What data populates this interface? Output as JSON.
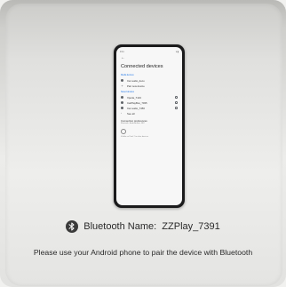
{
  "phone": {
    "status_time": "9:41",
    "status_icons": "▾ ▮",
    "back_glyph": "←",
    "title": "Connected devices",
    "section_media": "Media devices",
    "media_device": "Car audio_deco",
    "pair_new": "Pair new device",
    "section_previous": "Saved devices",
    "saved_devices": [
      "Xperia_7143",
      "CarPlayBox_7035",
      "Car audio_7456"
    ],
    "see_all": "See all",
    "prefs_title": "Connection preferences",
    "prefs_sub": "Bluetooth, Android Auto, NFC",
    "footer_note": "Visible as Pixel 7 to other devices"
  },
  "bluetooth": {
    "label": "Bluetooth Name:  ZZPlay_7391",
    "icon": "bluetooth-icon"
  },
  "instruction": "Please use your Android phone to pair the device with Bluetooth"
}
